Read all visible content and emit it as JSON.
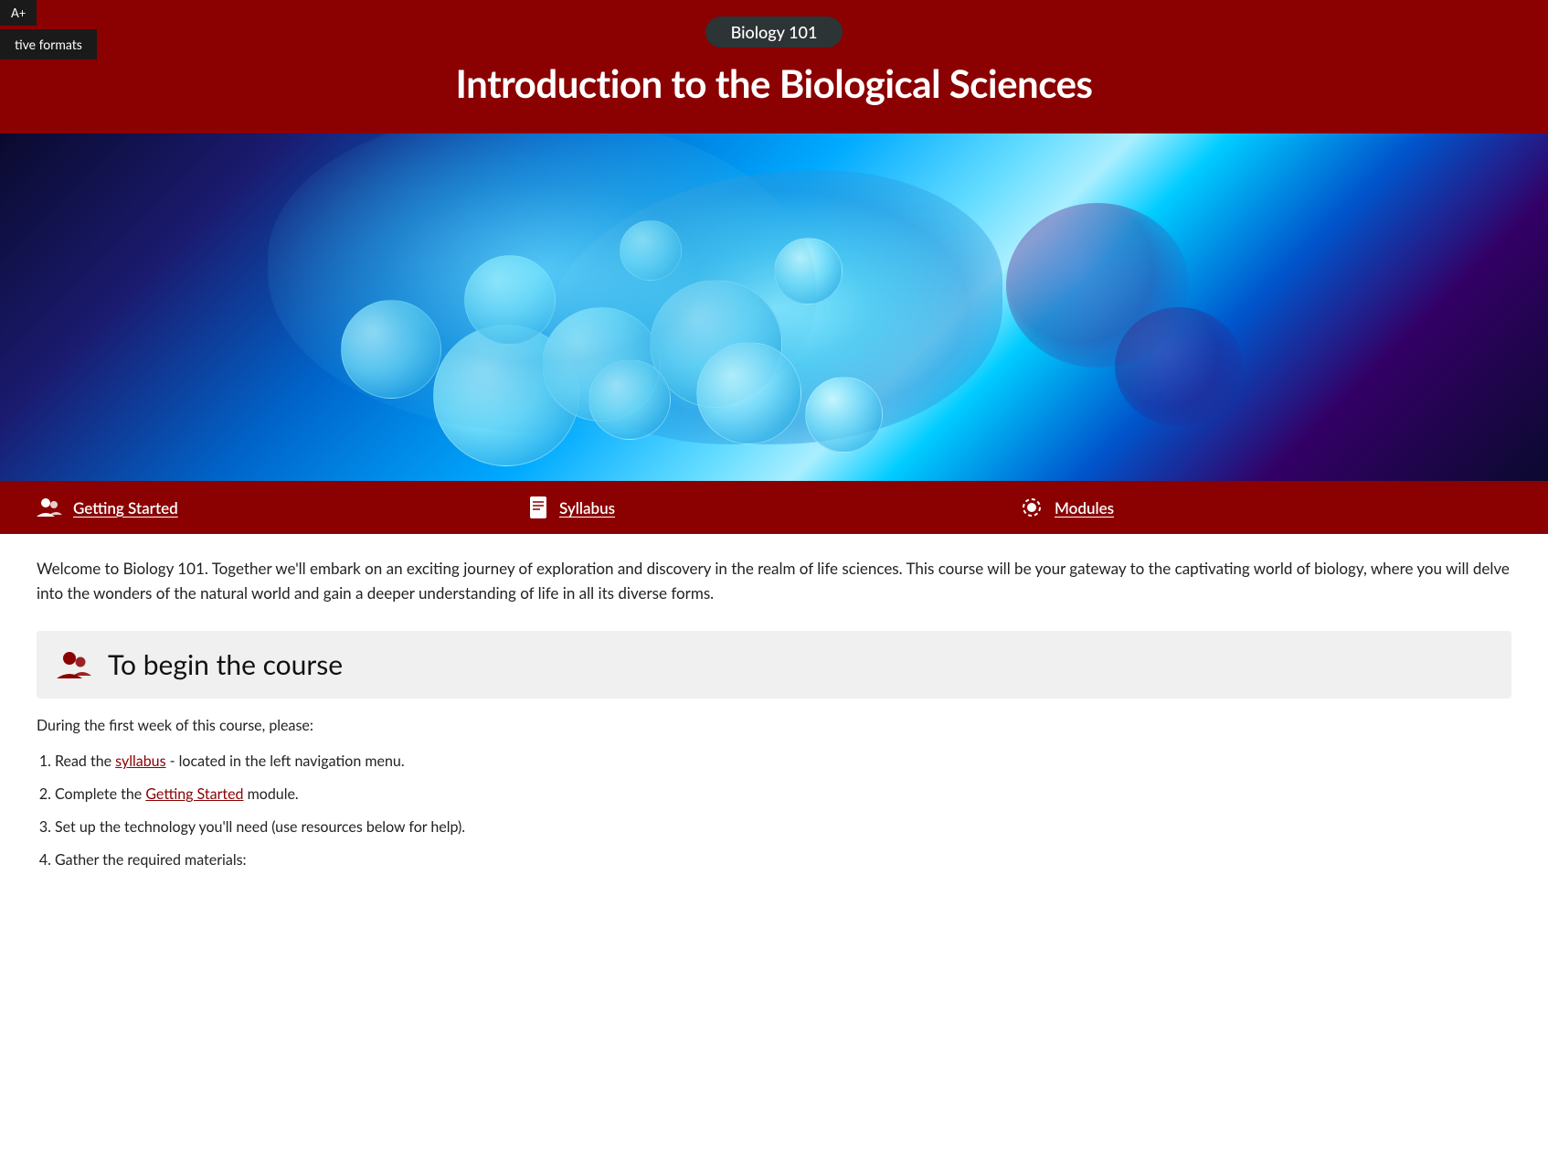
{
  "corner": {
    "button_label": "A+",
    "tooltip_text": "tive formats"
  },
  "header": {
    "course_tag": "Biology 101",
    "course_title": "Introduction to the Biological Sciences"
  },
  "nav": {
    "items": [
      {
        "label": "Getting Started",
        "icon": "people-icon"
      },
      {
        "label": "Syllabus",
        "icon": "document-icon"
      },
      {
        "label": "Modules",
        "icon": "settings-icon"
      }
    ]
  },
  "intro": {
    "text": "Welcome to Biology 101.  Together we'll embark on an exciting journey of exploration and discovery in the realm of life sciences. This course will be your gateway to the captivating world of biology, where you will delve into the wonders of the natural world and gain a deeper understanding of life in all its diverse forms."
  },
  "begin_section": {
    "title": "To begin the course",
    "first_week_text": "During the first week of this course, please:",
    "items": [
      {
        "text_before": "Read the ",
        "link": "syllabus",
        "text_after": " - located in the left navigation menu."
      },
      {
        "text_before": "Complete the ",
        "link": "Getting Started",
        "text_after": " module."
      },
      {
        "text_before": "Set up the technology you'll need (use resources below for help).",
        "link": "",
        "text_after": ""
      },
      {
        "text_before": "Gather the required materials:",
        "link": "",
        "text_after": ""
      }
    ]
  },
  "colors": {
    "brand_red": "#8b0000",
    "dark_nav": "#2d3436",
    "bg_section": "#f0f0f0"
  }
}
